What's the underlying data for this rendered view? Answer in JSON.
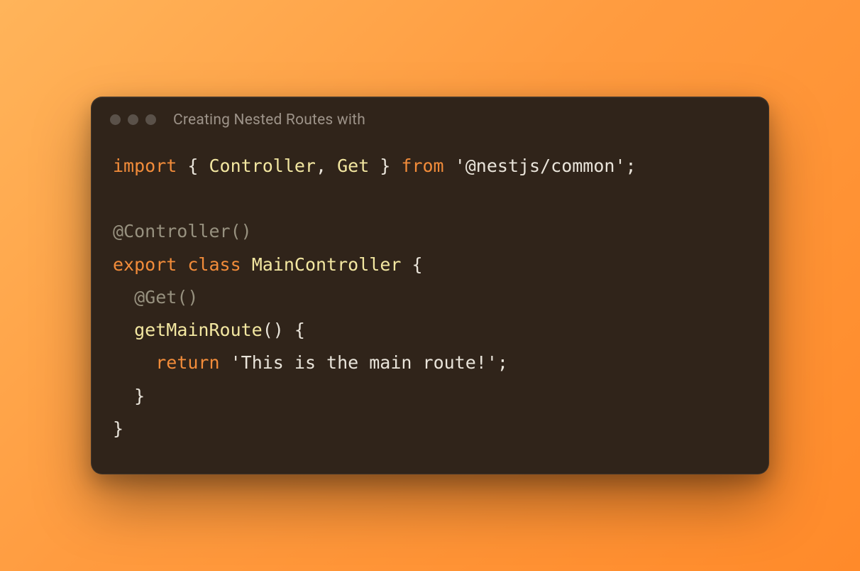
{
  "window": {
    "title": "Creating Nested Routes with"
  },
  "code": {
    "l1_import": "import",
    "l1_brace_open": " { ",
    "l1_ident1": "Controller",
    "l1_comma": ", ",
    "l1_ident2": "Get",
    "l1_brace_close": " } ",
    "l1_from": "from",
    "l1_space": " ",
    "l1_str": "'@nestjs/common'",
    "l1_semi": ";",
    "l3_dec": "@Controller()",
    "l4_export": "export",
    "l4_sp1": " ",
    "l4_class": "class",
    "l4_sp2": " ",
    "l4_name": "MainController",
    "l4_brace": " {",
    "l5_indent": "  ",
    "l5_dec": "@Get()",
    "l6_indent": "  ",
    "l6_name": "getMainRoute",
    "l6_parens": "() {",
    "l7_indent": "    ",
    "l7_return": "return",
    "l7_sp": " ",
    "l7_str": "'This is the main route!'",
    "l7_semi": ";",
    "l8_indent": "  ",
    "l8_brace": "}",
    "l9_brace": "}"
  }
}
